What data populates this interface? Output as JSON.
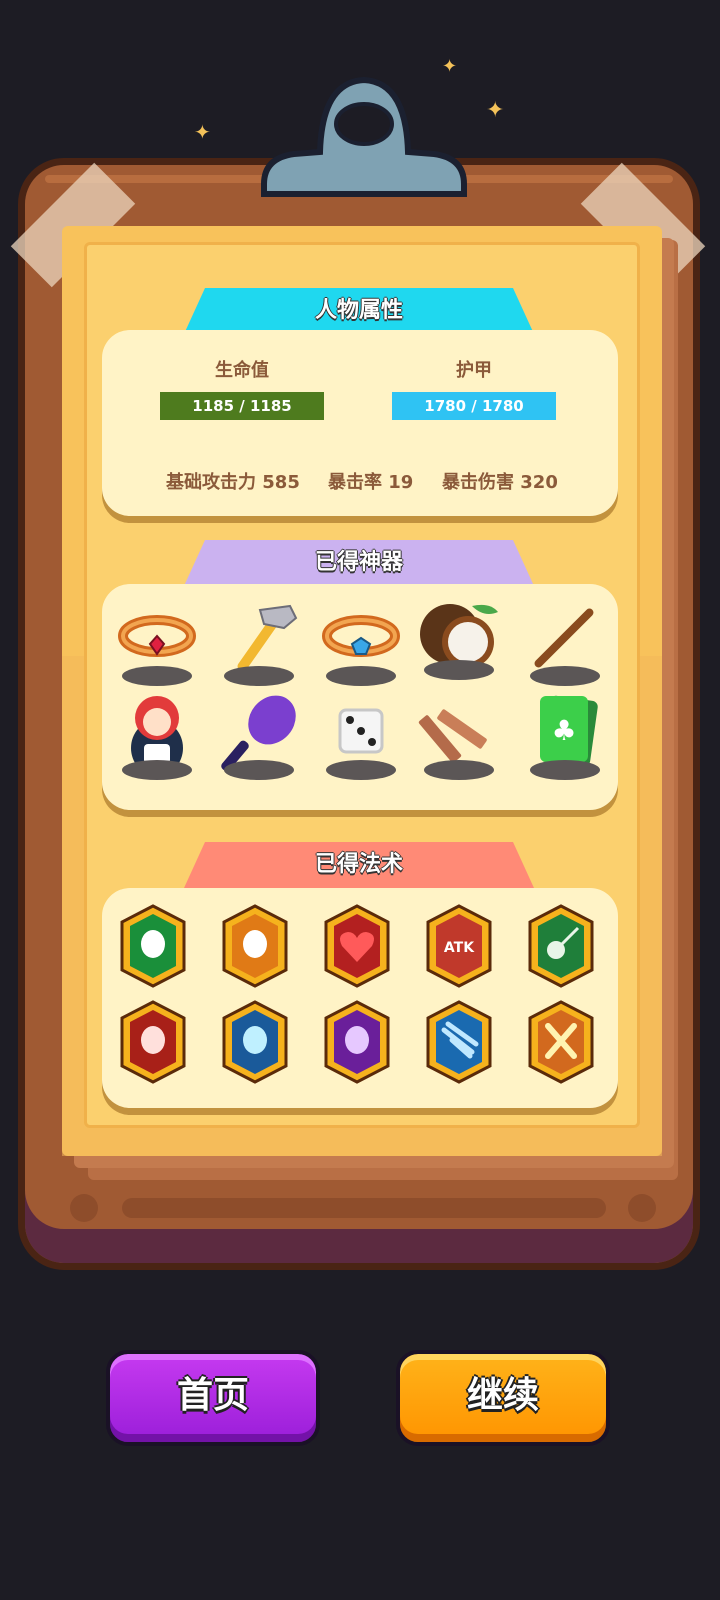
{
  "attributes": {
    "title": "人物属性",
    "hp_label": "生命值",
    "hp_value": "1185 / 1185",
    "armor_label": "护甲",
    "armor_value": "1780 / 1780",
    "base_attack": "基础攻击力 585",
    "crit_rate": "暴击率 19",
    "crit_damage": "暴击伤害 320"
  },
  "artifacts": {
    "title": "已得神器",
    "items": [
      "ruby-ring-icon",
      "hammer-icon",
      "sapphire-ring-icon",
      "coconut-icon",
      "wooden-staff-icon",
      "nesting-doll-icon",
      "tennis-racket-icon",
      "dice-icon",
      "wooden-sticks-icon",
      "playing-cards-icon"
    ]
  },
  "spells": {
    "title": "已得法术",
    "items": [
      "green-ghost-spell-icon",
      "orange-ghost-spell-icon",
      "heartbeat-spell-icon",
      "atk-boost-spell-icon",
      "poison-skull-spell-icon",
      "red-ghost-spell-icon",
      "blue-ghost-spell-icon",
      "purple-ghost-spell-icon",
      "ice-meteor-spell-icon",
      "crossed-swords-spell-icon"
    ],
    "atk_text": "ATK"
  },
  "buttons": {
    "home": "首页",
    "continue": "继续"
  },
  "colors": {
    "hp_bar": "#4e7b1e",
    "armor_bar": "#2fc3f3",
    "attr_tag": "#1fd8ef",
    "artifact_tag": "#cbb2f0",
    "spell_tag": "#ff8a76"
  }
}
